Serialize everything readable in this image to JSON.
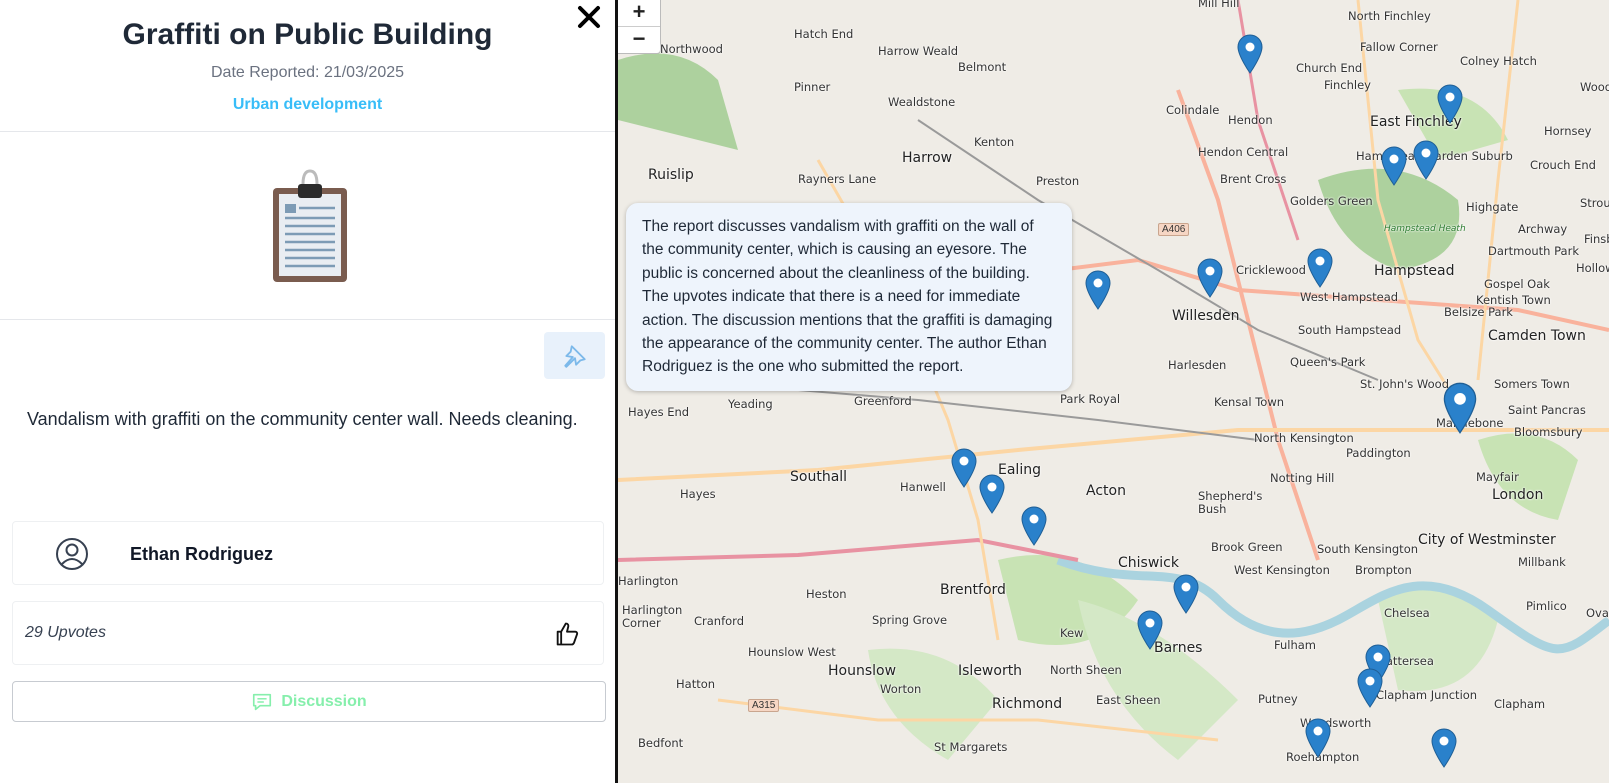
{
  "report": {
    "title": "Graffiti on Public Building",
    "date": "Date Reported: 21/03/2025",
    "category": "Urban development",
    "description": "Vandalism with graffiti on the community center wall. Needs cleaning.",
    "author": "Ethan Rodriguez",
    "upvotes": "29 Upvotes",
    "discussion_label": "Discussion",
    "close_label": "✕"
  },
  "map": {
    "zoom_in": "+",
    "zoom_out": "−",
    "summary": "The report discusses vandalism with graffiti on the wall of the community center, which is causing an eyesore. The public is concerned about the cleanliness of the building. The upvotes indicate that there is a need for immediate action. The discussion mentions that the graffiti is damaging the appearance of the community center. The author Ethan Rodriguez is the one who submitted the report.",
    "places": [
      "Northwood",
      "Hatch End",
      "Harrow Weald",
      "Belmont",
      "Pinner",
      "Wealdstone",
      "Mill Hill",
      "North Finchley",
      "Fallow Corner",
      "Colney Hatch",
      "Church End",
      "Finchley",
      "Wood",
      "East Finchley",
      "Hornsey",
      "Hendon",
      "Colindale",
      "Kenton",
      "Harrow",
      "Ruislip",
      "Rayners Lane",
      "Preston",
      "Hendon Central",
      "Brent Cross",
      "Golders Green",
      "Hampstead Garden Suburb",
      "Highgate",
      "Crouch End",
      "Stroud",
      "Archway",
      "Dartmouth Park",
      "Finsbu",
      "Hampstead Heath",
      "Hampstead",
      "Gospel Oak",
      "Holloway",
      "Cricklewood",
      "West Hampstead",
      "Kentish Town",
      "Willesden",
      "South Hampstead",
      "Belsize Park",
      "Camden Town",
      "Harlesden",
      "Queen's Park",
      "St. John's Wood",
      "Somers Town",
      "Hayes End",
      "Yeading",
      "Greenford",
      "Park Royal",
      "Kensal Town",
      "Marylebone",
      "Saint Pancras",
      "Bloomsbury",
      "North Kensington",
      "Paddington",
      "Southall",
      "Hanwell",
      "Ealing",
      "Acton",
      "Notting Hill",
      "Mayfair",
      "Hayes",
      "Shepherd's Bush",
      "London",
      "Brook Green",
      "South Kensington",
      "City of Westminster",
      "Millbank",
      "West Kensington",
      "Brompton",
      "Chelsea",
      "Pimlico",
      "Harlington",
      "Heston",
      "Brentford",
      "Chiswick",
      "Oval",
      "Harlington Corner",
      "Cranford",
      "Spring Grove",
      "Kew",
      "Fulham",
      "Hounslow West",
      "Barnes",
      "Battersea",
      "Hounslow",
      "Isleworth",
      "North Sheen",
      "Hatton",
      "Worton",
      "Richmond",
      "East Sheen",
      "Putney",
      "Clapham Junction",
      "Clapham",
      "Wandsworth",
      "Bedfont",
      "St Margarets",
      "Roehampton"
    ],
    "road_badges": [
      "A406",
      "A315"
    ]
  },
  "colors": {
    "accent_blue": "#38bdf8",
    "discussion_green": "#86efac",
    "marker_blue": "#2a81cb"
  },
  "icons": {
    "close": "close-icon",
    "clipboard": "clipboard-icon",
    "pin": "pin-icon",
    "user": "user-circle-icon",
    "thumb": "thumbs-up-icon",
    "chat": "chat-bubble-icon",
    "marker": "map-marker-icon"
  }
}
